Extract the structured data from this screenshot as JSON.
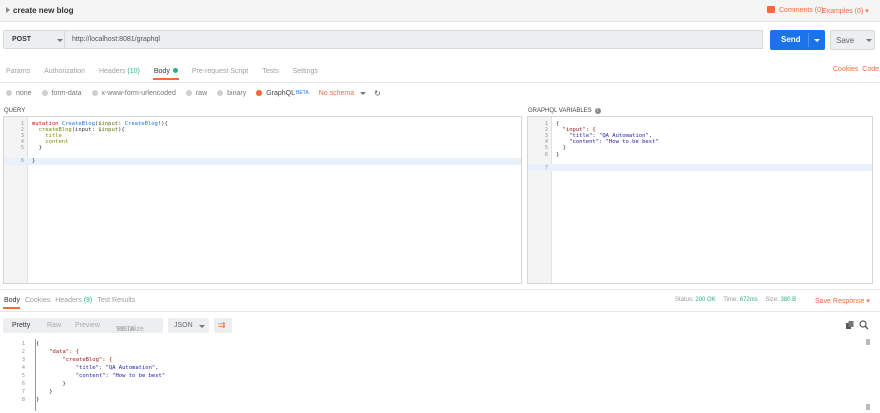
{
  "request": {
    "name": "create new blog",
    "comments_label": "Comments (0)",
    "examples_label": "Examples (0)",
    "method": "POST",
    "url": "http://localhost:8081/graphql",
    "send_label": "Send",
    "save_label": "Save"
  },
  "request_tabs": {
    "params": "Params",
    "authorization": "Authorization",
    "headers": "Headers",
    "headers_count": "(10)",
    "body": "Body",
    "prerequest": "Pre-request Script",
    "tests": "Tests",
    "settings": "Settings",
    "cookies": "Cookies",
    "code": "Code"
  },
  "body_types": {
    "none": "none",
    "form_data": "form-data",
    "urlencoded": "x-www-form-urlencoded",
    "raw": "raw",
    "binary": "binary",
    "graphql": "GraphQL",
    "beta": "BETA",
    "schema": "No schema",
    "selected": "GraphQL"
  },
  "query": {
    "label": "QUERY",
    "lines": [
      [
        "1",
        "mutation CreateBlog($input: CreateBlog!){"
      ],
      [
        "2",
        "  createBlog(input: $input){"
      ],
      [
        "3",
        "    title"
      ],
      [
        "4",
        "    content"
      ],
      [
        "5",
        "  }"
      ],
      [
        "6",
        "}"
      ]
    ]
  },
  "variables": {
    "label": "GRAPHQL VARIABLES",
    "lines": [
      [
        "1",
        "{"
      ],
      [
        "2",
        "  \"input\": {"
      ],
      [
        "3",
        "    \"title\": \"QA Automation\","
      ],
      [
        "4",
        "    \"content\": \"How to be best\""
      ],
      [
        "5",
        "  }"
      ],
      [
        "6",
        "}"
      ],
      [
        "7",
        ""
      ]
    ]
  },
  "response": {
    "tabs": {
      "body": "Body",
      "cookies": "Cookies",
      "headers": "Headers",
      "headers_count": "(9)",
      "test_results": "Test Results"
    },
    "status_label": "Status:",
    "status": "200 OK",
    "time_label": "Time:",
    "time": "672ms",
    "size_label": "Size:",
    "size": "380 B",
    "save_response": "Save Response",
    "view_modes": {
      "pretty": "Pretty",
      "raw": "Raw",
      "preview": "Preview",
      "visualize": "Visualize",
      "beta": "BETA"
    },
    "format": "JSON",
    "lines": [
      [
        "1",
        "{"
      ],
      [
        "2",
        "    \"data\": {"
      ],
      [
        "3",
        "        \"createBlog\": {"
      ],
      [
        "4",
        "            \"title\": \"QA Automation\","
      ],
      [
        "5",
        "            \"content\": \"How to be best\""
      ],
      [
        "6",
        "        }"
      ],
      [
        "7",
        "    }"
      ],
      [
        "8",
        "}"
      ]
    ]
  },
  "colors": {
    "accent": "#f26b3a",
    "primary": "#1a73e8",
    "success": "#26b47f"
  }
}
